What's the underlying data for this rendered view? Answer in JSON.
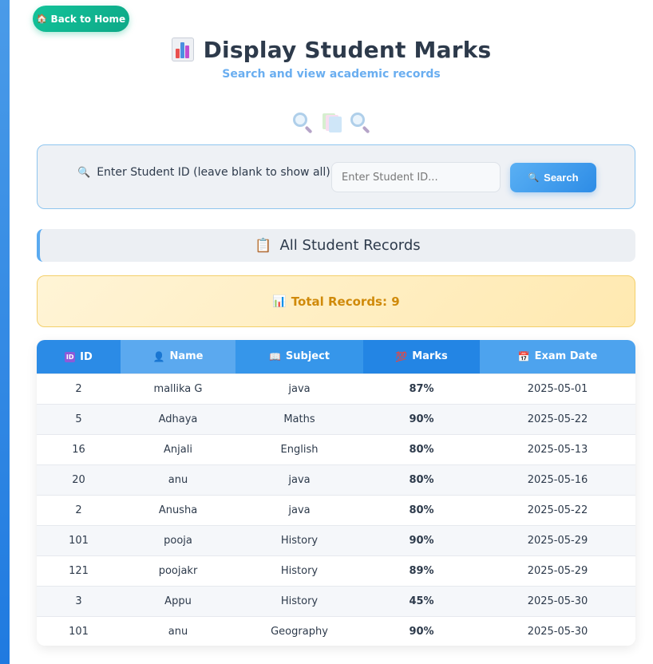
{
  "nav": {
    "back_label": "Back to Home"
  },
  "header": {
    "title": "Display Student Marks",
    "subtitle": "Search and view academic records"
  },
  "search": {
    "label": "Enter Student ID (leave blank to show all):",
    "placeholder": "Enter Student ID...",
    "value": "",
    "button_label": "Search"
  },
  "section": {
    "title": "All Student Records"
  },
  "summary": {
    "total_label": "Total Records: 9"
  },
  "table": {
    "columns": [
      "ID",
      "Name",
      "Subject",
      "Marks",
      "Exam Date"
    ],
    "rows": [
      [
        "2",
        "mallika G",
        "java",
        "87%",
        "2025-05-01"
      ],
      [
        "5",
        "Adhaya",
        "Maths",
        "90%",
        "2025-05-22"
      ],
      [
        "16",
        "Anjali",
        "English",
        "80%",
        "2025-05-13"
      ],
      [
        "20",
        "anu",
        "java",
        "80%",
        "2025-05-16"
      ],
      [
        "2",
        "Anusha",
        "java",
        "80%",
        "2025-05-22"
      ],
      [
        "101",
        "pooja",
        "History",
        "90%",
        "2025-05-29"
      ],
      [
        "121",
        "poojakr",
        "History",
        "89%",
        "2025-05-29"
      ],
      [
        "3",
        "Appu",
        "History",
        "45%",
        "2025-05-30"
      ],
      [
        "101",
        "anu",
        "Geography",
        "90%",
        "2025-05-30"
      ]
    ]
  },
  "colors": {
    "accent": "#2d8ce6",
    "back_button": "#12c39a",
    "title_text": "#2d3a4b",
    "subtitle_text": "#6aaef0",
    "total_text": "#d08a0a"
  },
  "icons": {
    "back": "house-icon",
    "title": "bar-chart-icon",
    "search": "magnifier-icon",
    "section": "clipboard-icon",
    "total": "bar-chart-icon",
    "id_col": "id-badge-icon",
    "name_col": "person-icon",
    "subject_col": "book-icon",
    "marks_col": "hundred-points-icon",
    "date_col": "calendar-icon"
  }
}
